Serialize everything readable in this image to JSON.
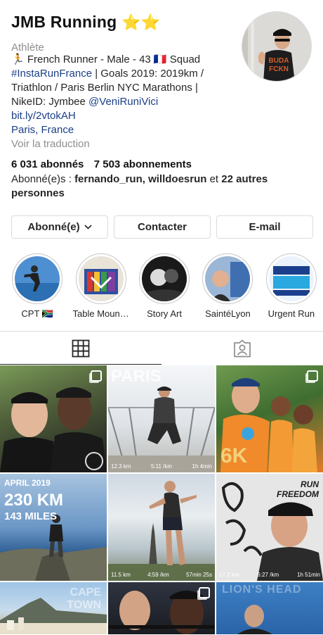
{
  "profile": {
    "name": "JMB Running",
    "stars": "⭐⭐",
    "category": "Athlète",
    "bio": {
      "line1": "🏃 French Runner - Male - 43 🇫🇷 Squad",
      "hashtag": "#InstaRunFrance",
      "line2_rest": " | Goals 2019: 2019km /",
      "line3": "Triathlon / Paris Berlin NYC Marathons |",
      "nike_prefix": "NikeID: Jymbee ",
      "mention": "@VeniRuniVici",
      "link": "bit.ly/2vtokAH",
      "location": "Paris, France",
      "translate": "Voir la traduction"
    },
    "followers": "6 031 abonnés",
    "following": "7 503 abonnements",
    "followed_by_prefix": "Abonné(e)s : ",
    "followed_by_names": "fernando_run, willdoesrun",
    "followed_by_and": " et ",
    "followed_by_others": "22 autres personnes"
  },
  "buttons": {
    "follow": "Abonné(e)",
    "contact": "Contacter",
    "email": "E-mail"
  },
  "highlights": [
    {
      "label": "CPT 🇿🇦"
    },
    {
      "label": "Table Moun…"
    },
    {
      "label": "Story Art"
    },
    {
      "label": "SaintéLyon"
    },
    {
      "label": "Urgent Run"
    }
  ],
  "tabs": {
    "grid": "grid-icon",
    "tagged": "tagged-person-icon"
  },
  "posts": [
    {
      "overlay": ""
    },
    {
      "overlay": "PARIS",
      "stats": [
        "12.3 km",
        "5:11 /km",
        "1h 4min"
      ]
    },
    {
      "overlay": "6K"
    },
    {
      "overlay": "APRIL 2019",
      "sub1": "230 KM",
      "sub2": "143 MILES"
    },
    {
      "overlay": "",
      "stats": [
        "11.5 km",
        "4:59 /km",
        "57min 25s"
      ]
    },
    {
      "overlay": "RUN FREEDOM",
      "stats": [
        "17.2 km",
        "6:27 /km",
        "1h 51min"
      ]
    },
    {
      "overlay": "CAPE TOWN"
    },
    {
      "overlay": ""
    },
    {
      "overlay": "LION'S HEAD"
    }
  ],
  "colors": {
    "link": "#1a3f86",
    "muted": "#8e8e8e",
    "border": "#dbdbdb"
  }
}
